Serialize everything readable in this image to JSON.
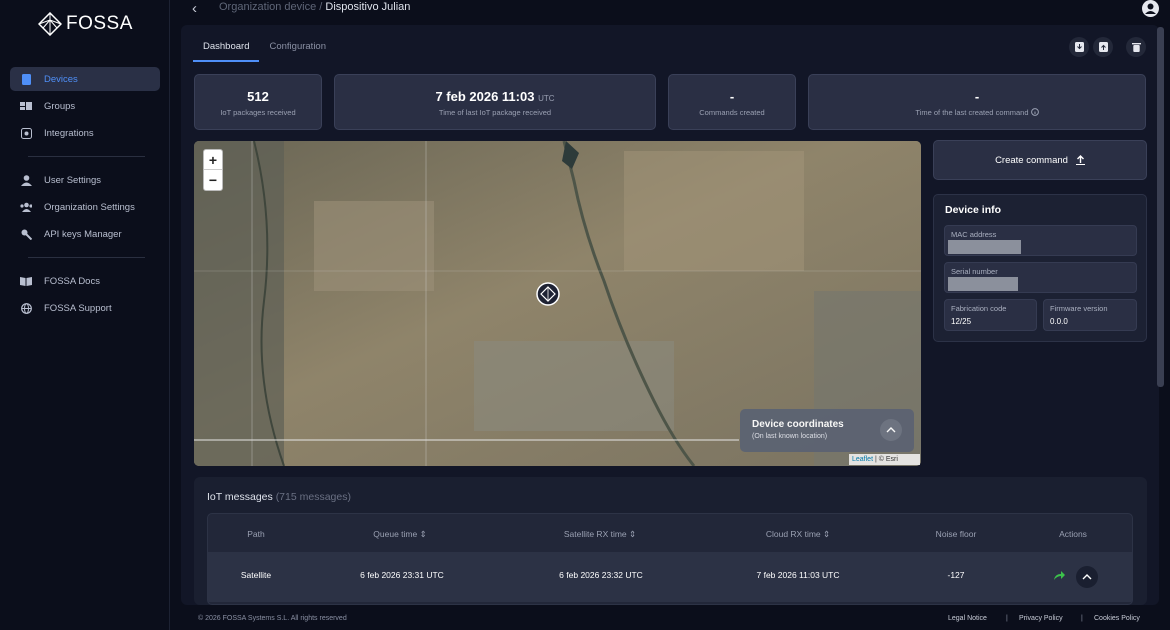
{
  "brand": {
    "name": "FOSSA"
  },
  "sidebar": {
    "items": [
      {
        "label": "Devices",
        "icon": "device-icon",
        "active": true
      },
      {
        "label": "Groups",
        "icon": "groups-icon"
      },
      {
        "label": "Integrations",
        "icon": "integrations-icon"
      },
      {
        "label": "User Settings",
        "icon": "user-icon"
      },
      {
        "label": "Organization Settings",
        "icon": "org-icon"
      },
      {
        "label": "API keys Manager",
        "icon": "key-icon"
      },
      {
        "label": "FOSSA Docs",
        "icon": "book-icon"
      },
      {
        "label": "FOSSA Support",
        "icon": "globe-icon"
      }
    ]
  },
  "breadcrumb": {
    "parent": "Organization device /",
    "current": "Dispositivo Julian"
  },
  "tabs": [
    {
      "label": "Dashboard",
      "active": true
    },
    {
      "label": "Configuration"
    }
  ],
  "stats": [
    {
      "value": "512",
      "unit": "",
      "label": "IoT packages received"
    },
    {
      "value": "7 feb 2026 11:03",
      "unit": "UTC",
      "label": "Time of last IoT package received"
    },
    {
      "value": "-",
      "unit": "",
      "label": "Commands created"
    },
    {
      "value": "-",
      "unit": "",
      "label": "Time of the last created command"
    }
  ],
  "map": {
    "zoom_in": "+",
    "zoom_out": "−",
    "coords_title": "Device coordinates",
    "coords_sub": "(On last known location)",
    "attribution_link": "Leaflet",
    "attribution_rest": " | © Esri"
  },
  "create_command": {
    "label": "Create command"
  },
  "device_info": {
    "title": "Device info",
    "mac_label": "MAC address",
    "serial_label": "Serial number",
    "fab_label": "Fabrication code",
    "fab_value": "12/25",
    "fw_label": "Firmware version",
    "fw_value": "0.0.0"
  },
  "messages": {
    "title": "IoT messages",
    "count": "(715 messages)",
    "columns": [
      "Path",
      "Queue time",
      "Satellite RX time",
      "Cloud RX time",
      "Noise floor",
      "Actions"
    ],
    "rows": [
      {
        "path": "Satellite",
        "queue": "6 feb 2026 23:31 UTC",
        "sat": "6 feb 2026 23:32 UTC",
        "cloud": "7 feb 2026 11:03 UTC",
        "noise": "-127"
      }
    ]
  },
  "footer": {
    "copyright": "© 2026 FOSSA Systems S.L. All rights reserved",
    "legal": "Legal Notice",
    "privacy": "Privacy Policy",
    "cookies": "Cookies Policy",
    "sep": "|"
  },
  "colors": {
    "accent": "#4f8ff7",
    "background": "#0b0e1b",
    "panel": "#121627",
    "card": "#2a2f44"
  }
}
